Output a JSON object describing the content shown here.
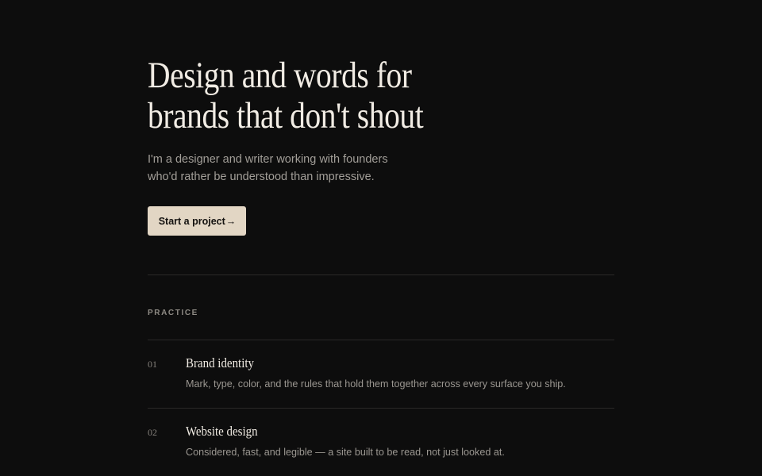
{
  "hero": {
    "title_lines": [
      "Design and words for",
      "brands that don't shout"
    ],
    "subtitle_lines": [
      "I'm a designer and writer working with founders",
      "who'd rather be understood than impressive."
    ],
    "cta_label": "Start a project",
    "cta_arrow": "→"
  },
  "practice": {
    "label": "PRACTICE",
    "items": [
      {
        "num": "01",
        "title": "Brand identity",
        "desc": "Mark, type, color, and the rules that hold them together across every surface you ship."
      },
      {
        "num": "02",
        "title": "Website design",
        "desc": "Considered, fast, and legible — a site built to be read, not just looked at."
      }
    ]
  },
  "colors": {
    "background": "#0d0d0d",
    "accent_button": "#e2d6c4",
    "heading_text": "#f1ece4",
    "muted_text": "#a29e98"
  }
}
